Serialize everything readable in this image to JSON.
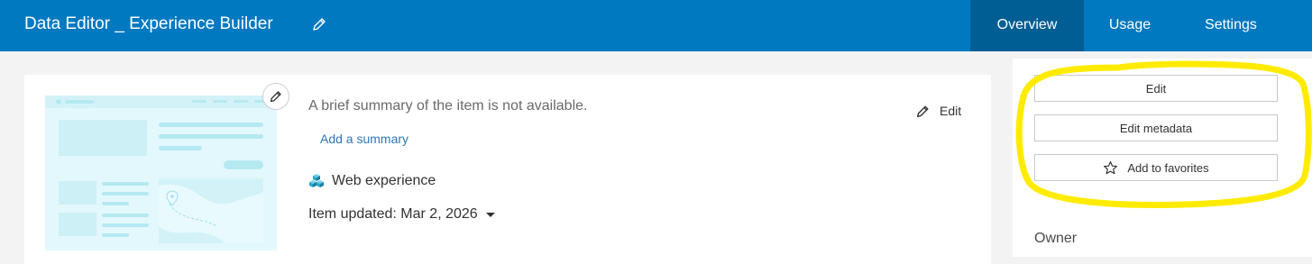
{
  "header": {
    "title": "Data Editor _ Experience Builder",
    "tabs": [
      {
        "label": "Overview",
        "active": true
      },
      {
        "label": "Usage",
        "active": false
      },
      {
        "label": "Settings",
        "active": false
      }
    ]
  },
  "overview": {
    "summary_text": "A brief summary of the item is not available.",
    "add_summary_link": "Add a summary",
    "edit_label": "Edit",
    "item_type": "Web experience",
    "item_updated": "Item updated: Mar 2, 2026"
  },
  "sidebar": {
    "buttons": [
      {
        "label": "Edit",
        "icon": "none"
      },
      {
        "label": "Edit metadata",
        "icon": "none"
      },
      {
        "label": "Add to favorites",
        "icon": "star-outline-icon"
      }
    ],
    "owner_label": "Owner"
  },
  "colors": {
    "header_bg": "#0079c1",
    "active_tab_bg": "#005e95",
    "link": "#2d77b8",
    "highlight_annotation": "#ffeb00"
  }
}
